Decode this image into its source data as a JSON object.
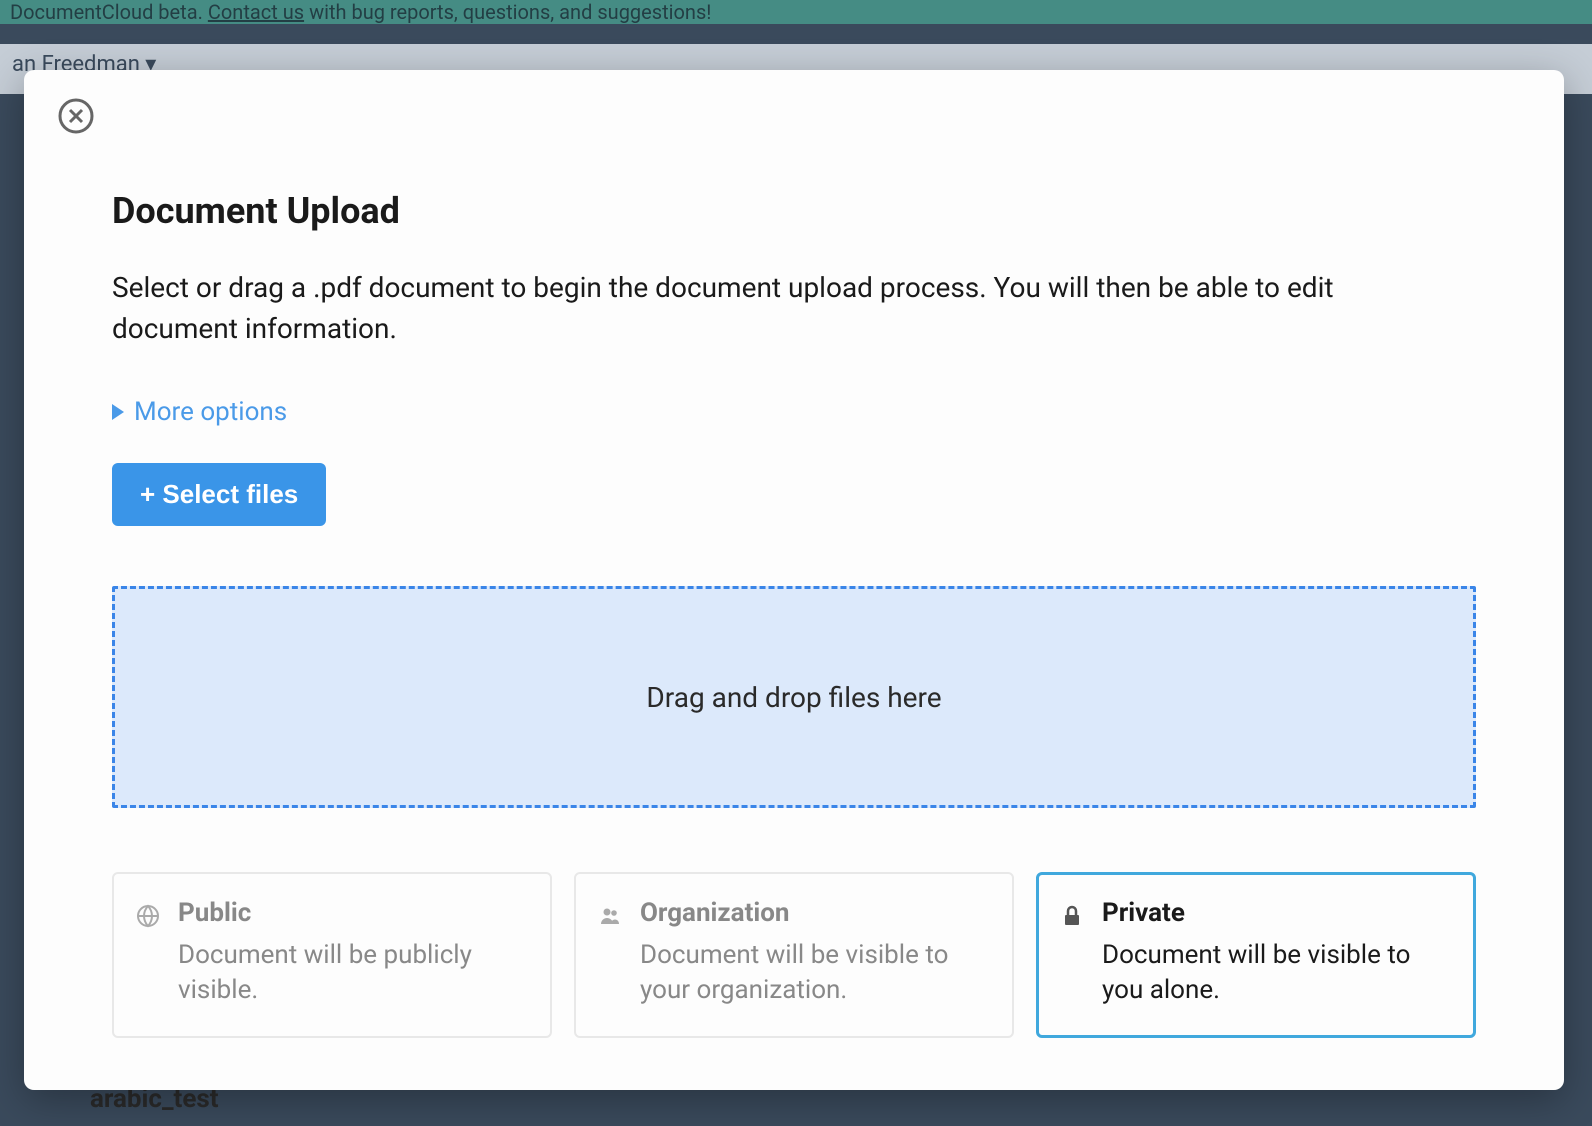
{
  "background": {
    "banner_prefix": "DocumentCloud beta.",
    "banner_link": "Contact us",
    "banner_suffix": "with bug reports, questions, and suggestions!",
    "user_name": "an Freedman ▾",
    "doc_name": "arabic_test"
  },
  "modal": {
    "title": "Document Upload",
    "description": "Select or drag a .pdf document to begin the document upload process. You will then be able to edit document information.",
    "more_options": "More options",
    "select_files": "+ Select files",
    "dropzone_text": "Drag and drop files here",
    "visibility": [
      {
        "key": "public",
        "title": "Public",
        "description": "Document will be publicly visible.",
        "selected": false
      },
      {
        "key": "organization",
        "title": "Organization",
        "description": "Document will be visible to your organization.",
        "selected": false
      },
      {
        "key": "private",
        "title": "Private",
        "description": "Document will be visible to you alone.",
        "selected": true
      }
    ]
  }
}
